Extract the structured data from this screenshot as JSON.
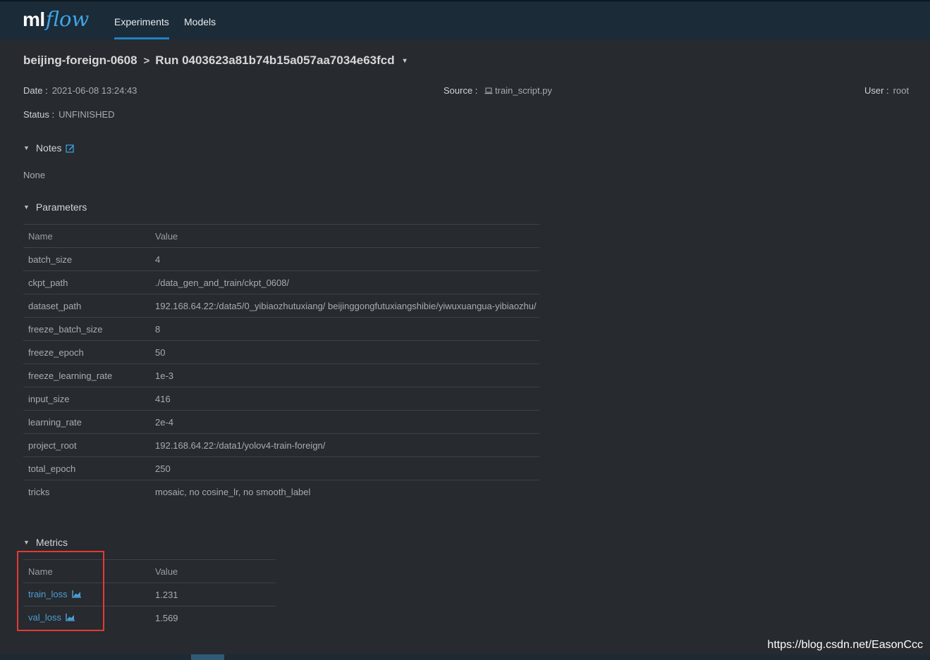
{
  "header": {
    "logo_ml": "ml",
    "logo_flow": "flow",
    "tabs": [
      {
        "label": "Experiments",
        "active": true
      },
      {
        "label": "Models",
        "active": false
      }
    ]
  },
  "breadcrumb": {
    "experiment": "beijing-foreign-0608",
    "separator": ">",
    "run": "Run 0403623a81b74b15a057aa7034e63fcd",
    "caret": "▾"
  },
  "meta": {
    "date_label": "Date :",
    "date_value": "2021-06-08 13:24:43",
    "source_label": "Source :",
    "source_value": "train_script.py",
    "user_label": "User :",
    "user_value": "root",
    "status_label": "Status :",
    "status_value": "UNFINISHED"
  },
  "notes": {
    "title": "Notes",
    "content": "None"
  },
  "parameters": {
    "title": "Parameters",
    "headers": {
      "name": "Name",
      "value": "Value"
    },
    "rows": [
      {
        "name": "batch_size",
        "value": "4"
      },
      {
        "name": "ckpt_path",
        "value": "./data_gen_and_train/ckpt_0608/"
      },
      {
        "name": "dataset_path",
        "value": "192.168.64.22:/data5/0_yibiaozhutuxiang/ beijinggongfutuxiangshibie/yiwuxuangua-yibiaozhu/"
      },
      {
        "name": "freeze_batch_size",
        "value": "8"
      },
      {
        "name": "freeze_epoch",
        "value": "50"
      },
      {
        "name": "freeze_learning_rate",
        "value": "1e-3"
      },
      {
        "name": "input_size",
        "value": "416"
      },
      {
        "name": "learning_rate",
        "value": "2e-4"
      },
      {
        "name": "project_root",
        "value": "192.168.64.22:/data1/yolov4-train-foreign/"
      },
      {
        "name": "total_epoch",
        "value": "250"
      },
      {
        "name": "tricks",
        "value": "mosaic, no cosine_lr, no smooth_label"
      }
    ]
  },
  "metrics": {
    "title": "Metrics",
    "headers": {
      "name": "Name",
      "value": "Value"
    },
    "rows": [
      {
        "name": "train_loss",
        "value": "1.231"
      },
      {
        "name": "val_loss",
        "value": "1.569"
      }
    ]
  },
  "watermark": "https://blog.csdn.net/EasonCcc",
  "colors": {
    "background": "#272a2e",
    "topbar": "#1b2b38",
    "accent": "#1f82c4",
    "link": "#4c9fd6",
    "highlight": "#e53935"
  }
}
